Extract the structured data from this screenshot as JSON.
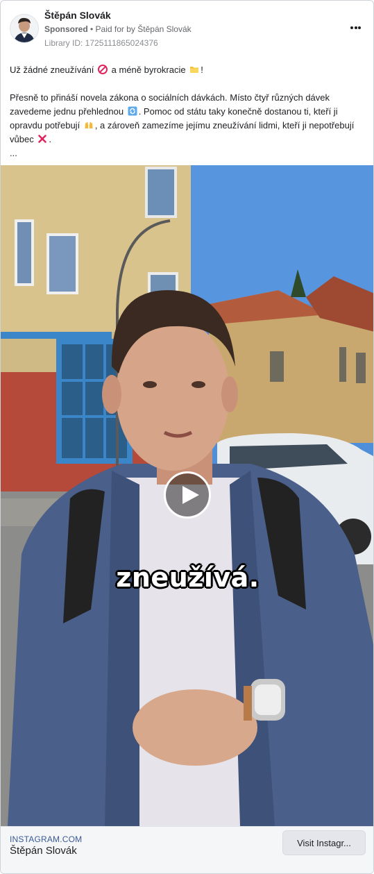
{
  "post": {
    "author": "Štěpán Slovák",
    "sponsored_label": "Sponsored",
    "paid_for_prefix": "• Paid for by",
    "paid_for_by": "Štěpán Slovák",
    "library_id": "Library ID: 1725111865024376",
    "more_icon": "more-horizontal-icon"
  },
  "body": {
    "line1_a": "Už žádné zneužívání",
    "line1_b": "a méně byrokracie",
    "line1_c": "!",
    "p2_a": "Přesně to přináší novela zákona o sociálních dávkách. Místo čtyř různých dávek zavedeme jednu přehlednou",
    "p2_b": ". Pomoc od státu taky konečně dostanou ti, kteří ji opravdu potřebují",
    "p2_c": ", a zároveň zamezíme jejímu zneužívání lidmi, kteří ji nepotřebují vůbec",
    "p2_d": ".",
    "ellipsis": "...",
    "emojis": [
      "no-entry-emoji",
      "folder-emoji",
      "arrows-cycle-emoji",
      "raised-hands-emoji",
      "cross-mark-emoji"
    ]
  },
  "media": {
    "caption": "zneužívá.",
    "play_icon": "play-icon"
  },
  "link": {
    "domain": "INSTAGRAM.COM",
    "title": "Štěpán Slovák",
    "cta_label": "Visit Instagr..."
  },
  "colors": {
    "link_domain": "#385898",
    "sky": "#4f8fd9",
    "building": "#d9c38d",
    "shirt": "#4a5f8a"
  }
}
